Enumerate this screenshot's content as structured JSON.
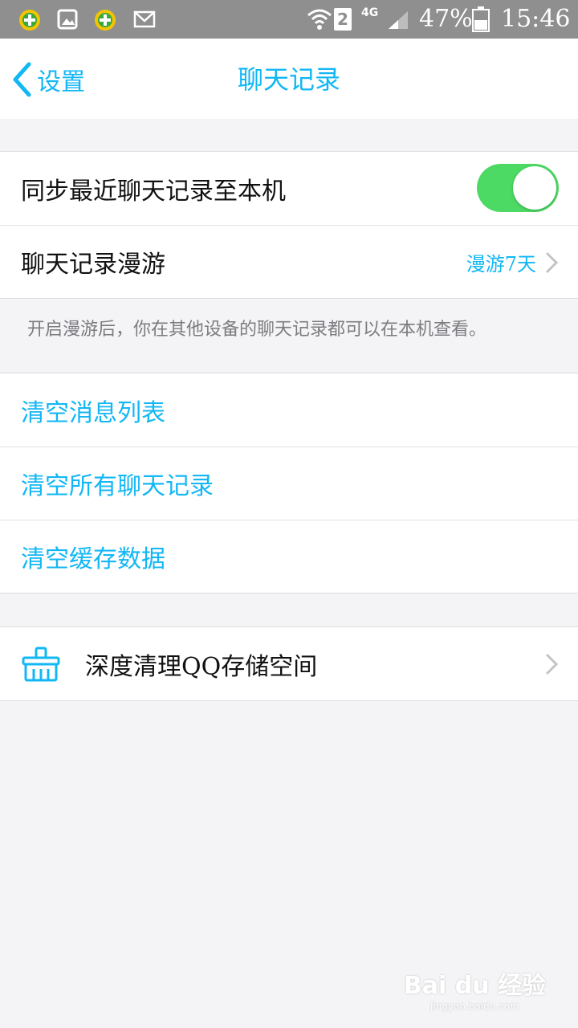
{
  "status_bar": {
    "signal_sim": "2",
    "network": "4G",
    "battery": "47%",
    "time": "15:46",
    "icons": [
      "360-security-icon",
      "gallery-icon",
      "360-security-icon",
      "mail-icon",
      "wifi-icon",
      "sim-icon",
      "signal-icon",
      "battery-icon"
    ]
  },
  "nav": {
    "back_label": "设置",
    "title": "聊天记录"
  },
  "sync_group": {
    "sync_label": "同步最近聊天记录至本机",
    "sync_enabled": true,
    "roam_label": "聊天记录漫游",
    "roam_value": "漫游7天"
  },
  "footnote": "开启漫游后，你在其他设备的聊天记录都可以在本机查看。",
  "clear_group": {
    "clear_messages": "清空消息列表",
    "clear_all_history": "清空所有聊天记录",
    "clear_cache": "清空缓存数据"
  },
  "storage_group": {
    "deep_clean_label": "深度清理QQ存储空间"
  },
  "colors": {
    "accent": "#12b7f5",
    "toggle_on": "#4cd964",
    "background": "#f4f4f7",
    "status_bar": "#8f8f8f"
  },
  "watermark": {
    "brand": "Bai du 经验",
    "url": "jingyan.baidu.com"
  }
}
